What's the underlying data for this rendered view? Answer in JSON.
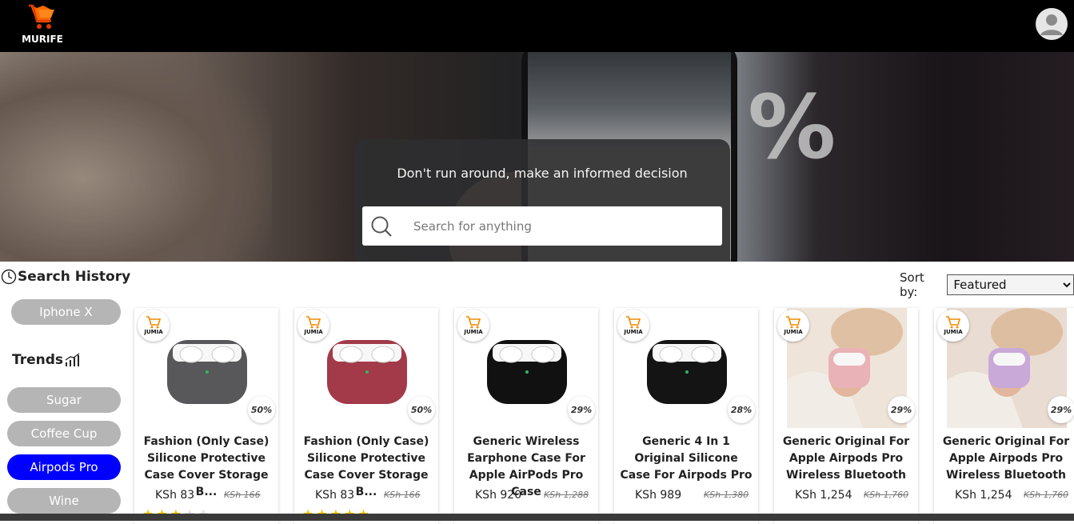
{
  "app": {
    "logo_text": "MURIFE"
  },
  "hero": {
    "tagline": "Don't run around, make an informed decision",
    "search_placeholder": "Search for anything"
  },
  "history": {
    "title": "Search History",
    "items": [
      "Iphone X"
    ]
  },
  "sort": {
    "label": "Sort by:",
    "selected": "Featured"
  },
  "trends": {
    "title": "Trends",
    "items": [
      {
        "label": "Sugar",
        "active": false
      },
      {
        "label": "Coffee Cup",
        "active": false
      },
      {
        "label": "Airpods Pro",
        "active": true
      },
      {
        "label": "Wine",
        "active": false
      }
    ]
  },
  "products": [
    {
      "store": "JUMIA",
      "discount": "50%",
      "title": "Fashion (Only Case) Silicone Protective Case Cover Storage B...",
      "price": "KSh 83",
      "old_price": "KSh 166",
      "rating": 3,
      "case_color": "#58585a"
    },
    {
      "store": "JUMIA",
      "discount": "50%",
      "title": "Fashion (Only Case) Silicone Protective Case Cover Storage B...",
      "price": "KSh 83",
      "old_price": "KSh 166",
      "rating": 5,
      "case_color": "#a23a4a"
    },
    {
      "store": "JUMIA",
      "discount": "29%",
      "title": "Generic Wireless Earphone Case For Apple AirPods Pro Case",
      "price": "KSh 920",
      "old_price": "KSh 1,288",
      "rating": 0,
      "case_color": "#111111"
    },
    {
      "store": "JUMIA",
      "discount": "28%",
      "title": "Generic 4 In 1 Original Silicone Case For Airpods Pro",
      "price": "KSh 989",
      "old_price": "KSh 1,380",
      "rating": 0,
      "case_color": "#141414"
    },
    {
      "store": "JUMIA",
      "discount": "29%",
      "title": "Generic Original For Apple Airpods Pro Wireless Bluetooth",
      "price": "KSh 1,254",
      "old_price": "KSh 1,760",
      "rating": 0,
      "case_color": "#e9b2b6"
    },
    {
      "store": "JUMIA",
      "discount": "29%",
      "title": "Generic Original For Apple Airpods Pro Wireless Bluetooth",
      "price": "KSh 1,254",
      "old_price": "KSh 1,760",
      "rating": 0,
      "case_color": "#c9a9d8"
    }
  ],
  "colors": {
    "topbar": "#000000",
    "accent_active_chip": "#0000ff",
    "chip": "#b5b5b5",
    "logo_orange": "#ff6a00",
    "star": "#f2c200"
  },
  "icons": [
    "shopping-cart-logo-icon",
    "user-avatar-icon",
    "search-icon",
    "clock-icon",
    "trending-chart-icon",
    "store-cart-icon"
  ]
}
